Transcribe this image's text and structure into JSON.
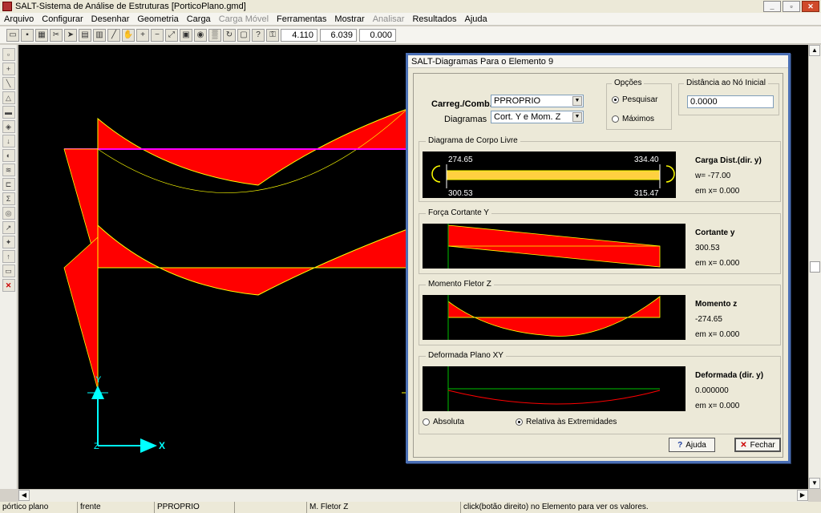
{
  "window": {
    "title": "SALT-Sistema de Análise de Estruturas [PorticoPlano.gmd]",
    "minimize": "_",
    "restore": "▫",
    "close": "✕"
  },
  "menu": [
    {
      "label": "Arquivo",
      "enabled": true
    },
    {
      "label": "Configurar",
      "enabled": true
    },
    {
      "label": "Desenhar",
      "enabled": true
    },
    {
      "label": "Geometria",
      "enabled": true
    },
    {
      "label": "Carga",
      "enabled": true
    },
    {
      "label": "Carga Móvel",
      "enabled": false
    },
    {
      "label": "Ferramentas",
      "enabled": true
    },
    {
      "label": "Mostrar",
      "enabled": true
    },
    {
      "label": "Analisar",
      "enabled": false
    },
    {
      "label": "Resultados",
      "enabled": true
    },
    {
      "label": "Ajuda",
      "enabled": true
    }
  ],
  "toolbar": {
    "coord_x": "4.110",
    "coord_y": "6.039",
    "coord_z": "0.000"
  },
  "canvas": {
    "axis_y": "Y",
    "axis_z": "Z",
    "axis_x": "X",
    "colors": {
      "diagram_fill": "#ff0000",
      "diagram_edge": "#ffff00",
      "bar": "#ff00ff",
      "axes": "#00ffff"
    }
  },
  "dialog": {
    "title": "SALT-Diagramas Para o Elemento 9",
    "carreg_label": "Carreg./Comb.",
    "carreg_value": "PPROPRIO",
    "diagramas_label": "Diagramas",
    "diagramas_value": "Cort. Y e Mom. Z",
    "opcoes_label": "Opções",
    "opt_pesquisar": "Pesquisar",
    "opt_maximos": "Máximos",
    "distancia_label": "Distância ao Nó Inicial",
    "distancia_value": "0.0000",
    "corpo_livre": {
      "label": "Diagrama de Corpo Livre",
      "left_top": "274.65",
      "right_top": "334.40",
      "left_bottom": "300.53",
      "right_bottom": "315.47",
      "side_title": "Carga Dist.(dir. y)",
      "side_value": "w= -77.00",
      "side_pos": "em x= 0.000"
    },
    "cortante": {
      "label": "Força Cortante Y",
      "side_title": "Cortante y",
      "side_value": "300.53",
      "side_pos": "em x= 0.000"
    },
    "momento": {
      "label": "Momento Fletor Z",
      "side_title": "Momento z",
      "side_value": "-274.65",
      "side_pos": "em x= 0.000"
    },
    "deformada": {
      "label": "Deformada Plano XY",
      "side_title": "Deformada (dir. y)",
      "side_value": "0.000000",
      "side_pos": "em x= 0.000",
      "opt_absoluta": "Absoluta",
      "opt_relativa": "Relativa às Extremidades"
    },
    "btn_ajuda": "Ajuda",
    "btn_fechar": "Fechar"
  },
  "statusbar": {
    "c1": "pórtico plano",
    "c2": "frente",
    "c3": "PPROPRIO",
    "c4": "",
    "c5": "M. Fletor Z",
    "c6": "click(botão direito) no Elemento para ver os valores."
  }
}
